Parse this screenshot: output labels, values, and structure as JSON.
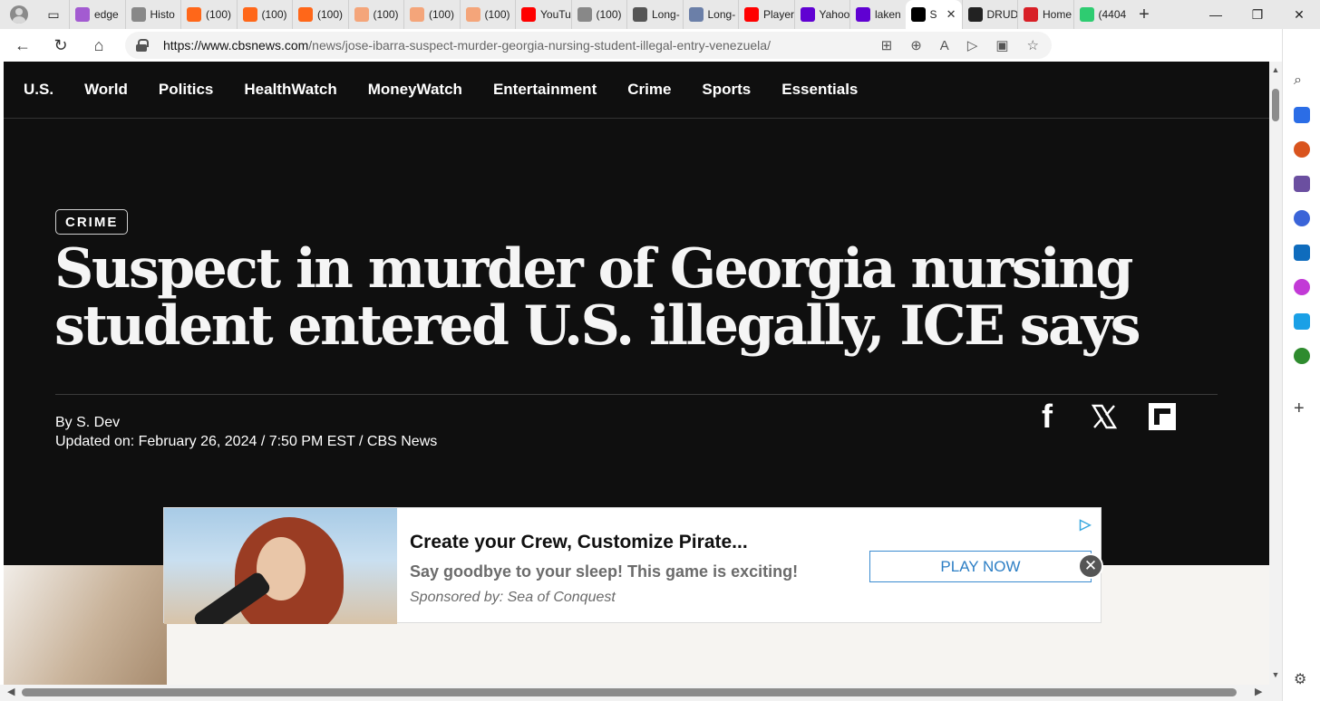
{
  "browser": {
    "tabs": [
      {
        "label": "edge",
        "icon": "yahoo-edge-icon",
        "color": "#a35bd1"
      },
      {
        "label": "Histo",
        "icon": "history-icon",
        "color": "#888888"
      },
      {
        "label": "(100)",
        "icon": "substack-icon",
        "color": "#ff6719"
      },
      {
        "label": "(100)",
        "icon": "substack-icon",
        "color": "#ff6719"
      },
      {
        "label": "(100)",
        "icon": "substack-icon",
        "color": "#ff6719"
      },
      {
        "label": "(100)",
        "icon": "substack-icon",
        "color": "#f4a57a"
      },
      {
        "label": "(100)",
        "icon": "substack-icon",
        "color": "#f4a57a"
      },
      {
        "label": "(100)",
        "icon": "substack-icon",
        "color": "#f4a57a"
      },
      {
        "label": "YouTu",
        "icon": "youtube-icon",
        "color": "#ff0000"
      },
      {
        "label": "(100)",
        "icon": "threads-icon",
        "color": "#888888"
      },
      {
        "label": "Long-",
        "icon": "arrow-tab-icon",
        "color": "#555555"
      },
      {
        "label": "Long-",
        "icon": "l-letter-icon",
        "color": "#6b7fa8"
      },
      {
        "label": "Player",
        "icon": "youtube-icon",
        "color": "#ff0000"
      },
      {
        "label": "Yahoo",
        "icon": "yahoo-icon",
        "color": "#6001d2"
      },
      {
        "label": "laken",
        "icon": "yahoo-icon",
        "color": "#6001d2"
      },
      {
        "label": "S",
        "icon": "cbs-eye-icon",
        "color": "#000000",
        "active": true
      },
      {
        "label": "DRUD",
        "icon": "drudge-icon",
        "color": "#222222"
      },
      {
        "label": "Home",
        "icon": "home-red-icon",
        "color": "#d81f26"
      },
      {
        "label": "(4404",
        "icon": "g-letter-icon",
        "color": "#2ecc71"
      }
    ],
    "url_host": "https://www.cbsnews.com",
    "url_path": "/news/jose-ibarra-suspect-murder-georgia-nursing-student-illegal-entry-venezuela/"
  },
  "site": {
    "nav": [
      "U.S.",
      "World",
      "Politics",
      "HealthWatch",
      "MoneyWatch",
      "Entertainment",
      "Crime",
      "Sports",
      "Essentials"
    ],
    "category": "CRIME",
    "headline": "Suspect in murder of Georgia nursing student entered U.S. illegally, ICE says",
    "byline": "By S. Dev",
    "updated": "Updated on: February 26, 2024 / 7:50 PM EST / CBS News"
  },
  "ad": {
    "title": "Create your Crew, Customize Pirate...",
    "subtitle": "Say goodbye to your sleep! This game is exciting!",
    "sponsor": "Sponsored by: Sea of Conquest",
    "cta": "PLAY NOW"
  },
  "sidebar_colors": [
    "#2b6de6",
    "#d9541e",
    "#6b4fa0",
    "#3a64d8",
    "#0f6cbd",
    "#c23ad6",
    "#1aa0e6",
    "#2e8b2e"
  ]
}
